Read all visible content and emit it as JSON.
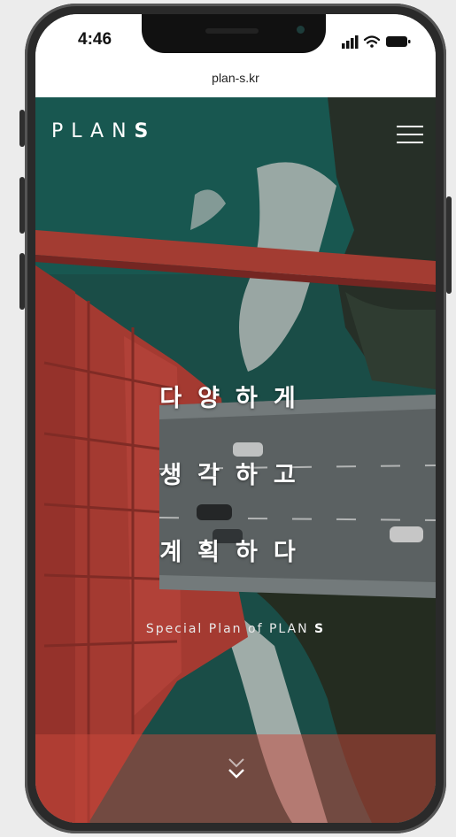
{
  "status_bar": {
    "time": "4:46"
  },
  "browser": {
    "url": "plan-s.kr"
  },
  "header": {
    "logo_light": "PLAN",
    "logo_bold": "S"
  },
  "hero": {
    "line1": "다양하게",
    "line2": "생각하고",
    "line3": "계획하다",
    "tagline_light": "Special Plan of PLAN",
    "tagline_bold": "S"
  },
  "colors": {
    "bridge_red": "#d0463c",
    "sea_green": "#1f6a60",
    "road_gray": "#6f7778"
  },
  "icons": [
    "signal-icon",
    "wifi-icon",
    "battery-icon",
    "hamburger-menu-icon",
    "chevron-down-icon"
  ]
}
